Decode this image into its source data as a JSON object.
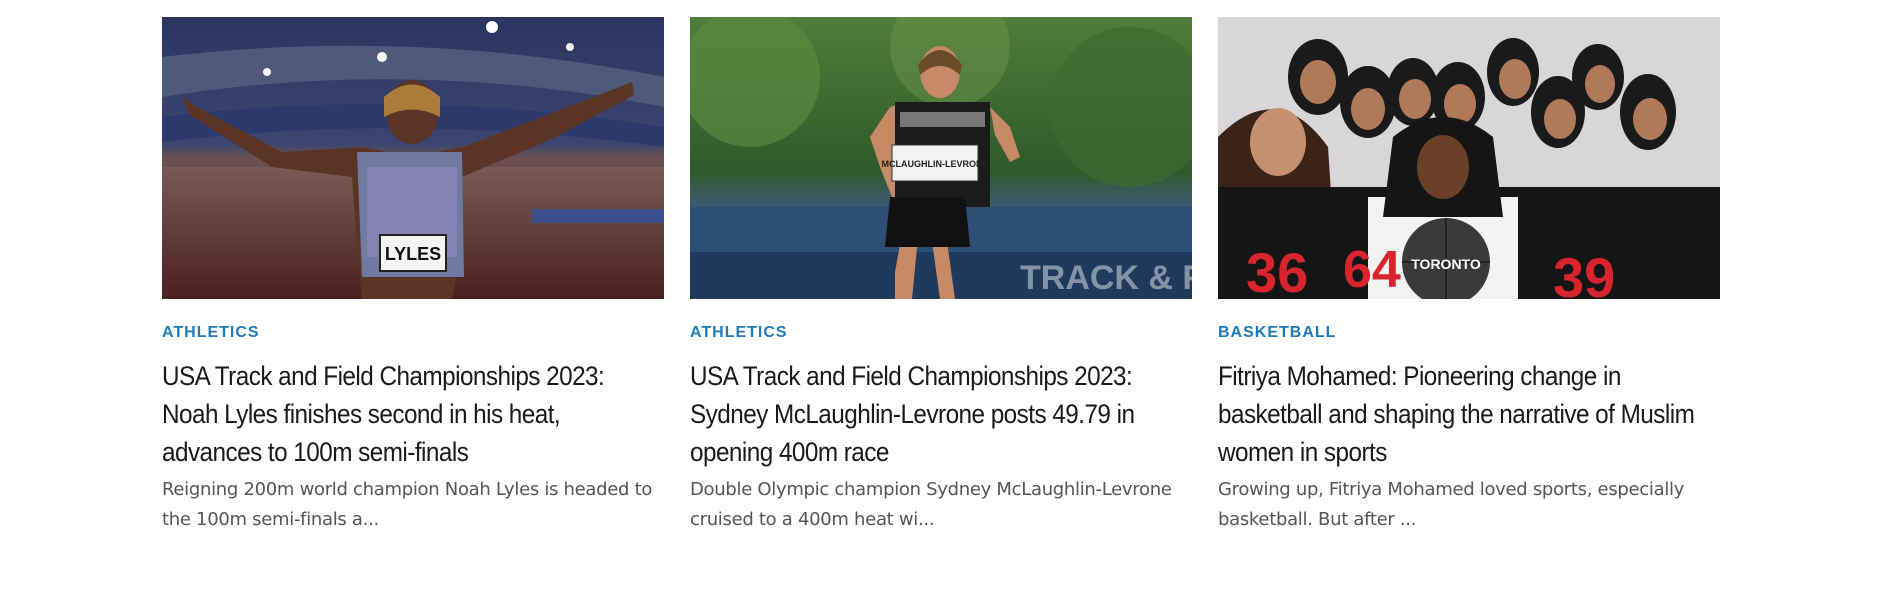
{
  "cards": [
    {
      "category": "ATHLETICS",
      "title": "USA Track and Field Championships 2023: Noah Lyles finishes second in his heat, advances to 100m semi-finals",
      "excerpt": "Reigning 200m world champion Noah Lyles is headed to the 100m semi-finals a...",
      "image_bib": "LYLES"
    },
    {
      "category": "ATHLETICS",
      "title": "USA Track and Field Championships 2023: Sydney McLaughlin-Levrone posts 49.79 in opening 400m race",
      "excerpt": "Double Olympic champion Sydney McLaughlin-Levrone cruised to a 400m heat wi...",
      "image_bib": "MCLAUGHLIN-LEVRONE",
      "image_banner": "TRACK & FI"
    },
    {
      "category": "BASKETBALL",
      "title": "Fitriya Mohamed: Pioneering change in basketball and shaping the narrative of Muslim women in sports",
      "excerpt": "Growing up, Fitriya Mohamed loved sports, especially basketball. But after ...",
      "image_ball_text": "TORONTO",
      "image_jersey_numbers": [
        "36",
        "64",
        "39"
      ]
    }
  ],
  "colors": {
    "category": "#1d7ab8",
    "headline": "#1a1a1a",
    "excerpt": "#555555"
  }
}
